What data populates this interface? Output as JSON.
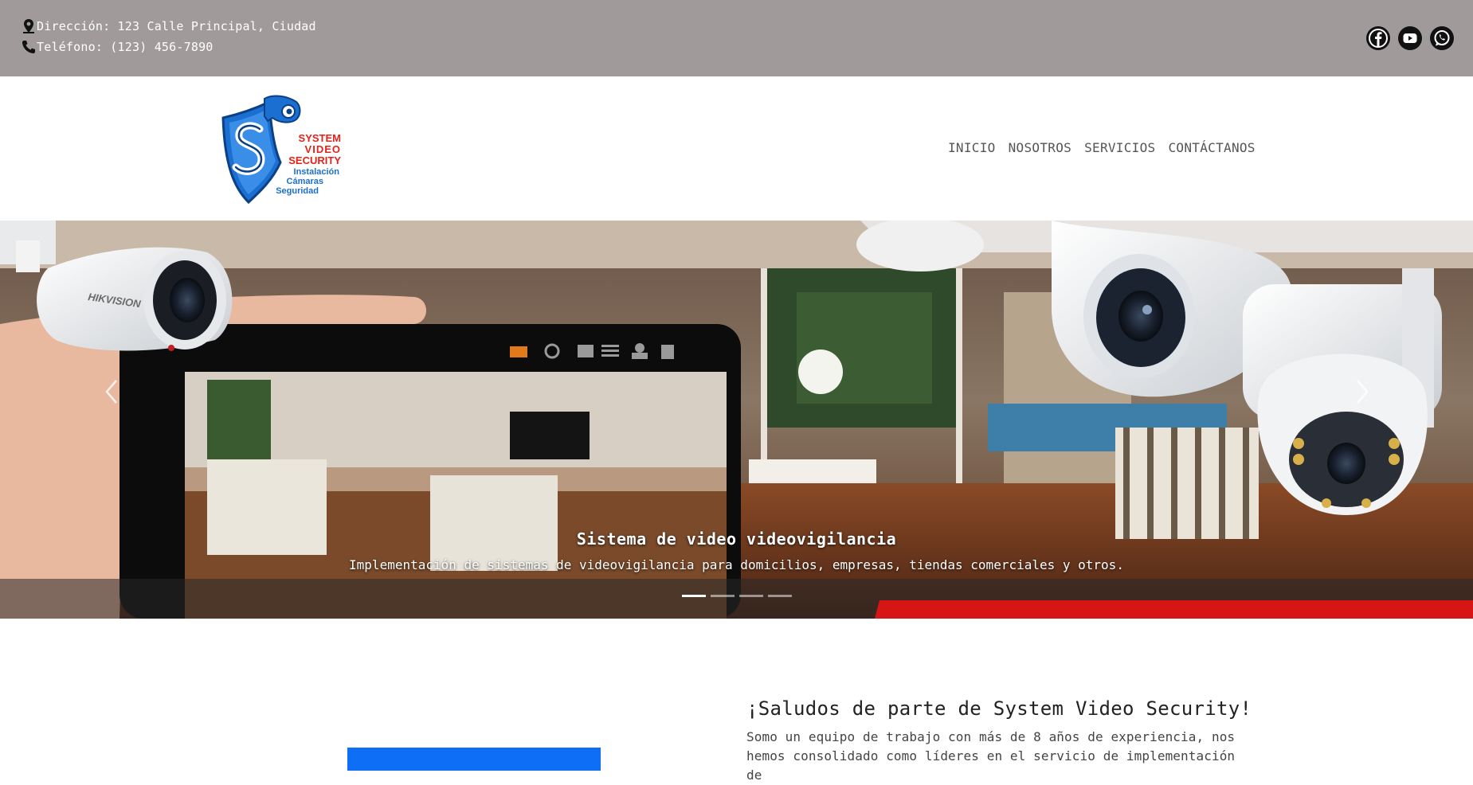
{
  "topbar": {
    "address": "Dirección: 123 Calle Principal, Ciudad",
    "phone": "Teléfono: (123) 456-7890",
    "social": [
      "facebook-icon",
      "youtube-icon",
      "whatsapp-icon"
    ],
    "background": "#a09a9b"
  },
  "logo": {
    "line1": "SYSTEM",
    "line2": "VIDEO",
    "line3": "SECURITY",
    "line4": "Instalación",
    "line5": "Cámaras",
    "line6": "Seguridad"
  },
  "nav": {
    "items": [
      "INICIO",
      "NOSOTROS",
      "SERVICIOS",
      "CONTÁCTANOS"
    ]
  },
  "hero": {
    "title": "Sistema de video videovigilancia",
    "text": "Implementación de sistemas de videovigilancia para domicilios, empresas, tiendas comerciales y otros.",
    "slides": 4,
    "active_slide": 1,
    "accent": "#d71515"
  },
  "welcome": {
    "title": "¡Saludos de parte de System Video Security!",
    "text": "Somo un equipo de trabajo con más de 8 años de experiencia, nos hemos consolidado como líderes en el servicio de implementación de",
    "accent": "#0e6ef5"
  }
}
